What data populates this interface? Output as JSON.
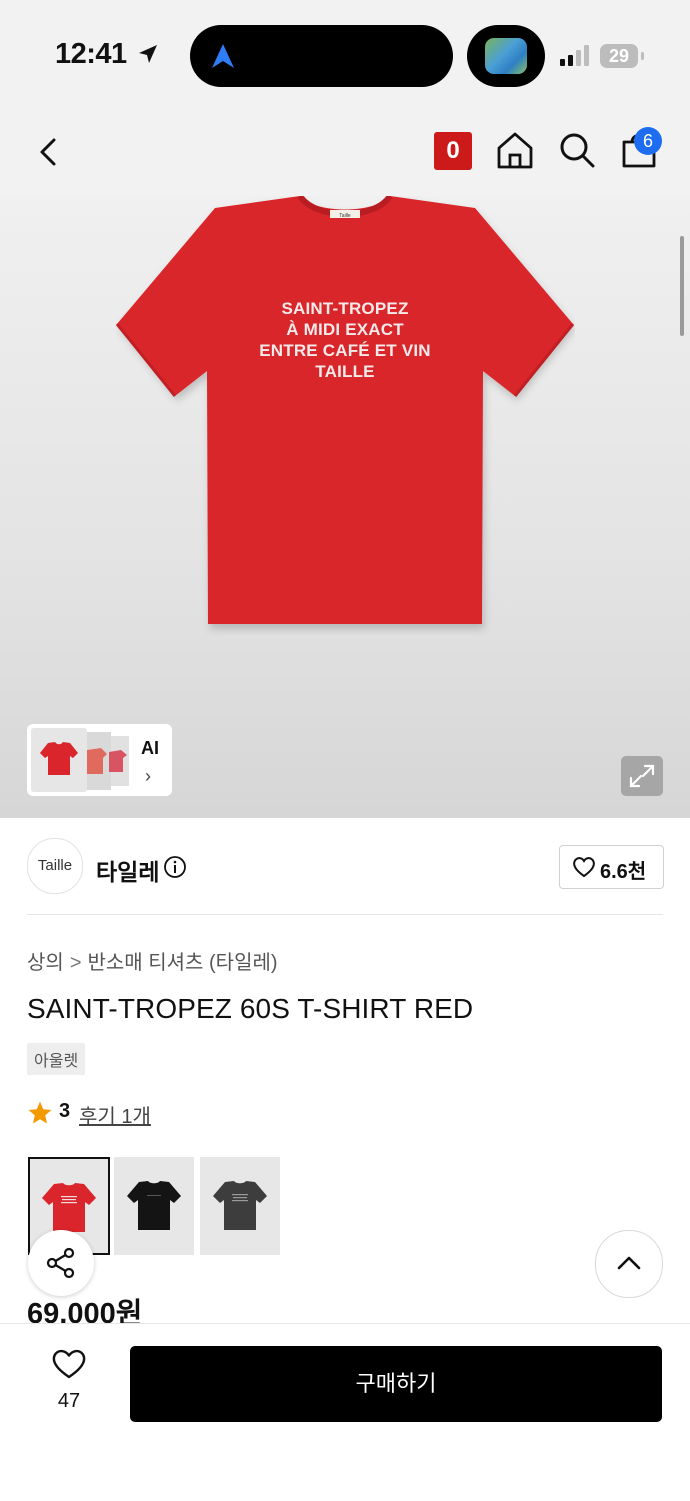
{
  "status_bar": {
    "time": "12:41",
    "battery": "29"
  },
  "nav": {
    "cart_zero_badge": "0",
    "cart_count": "6"
  },
  "product_image": {
    "shirt_text": [
      "SAINT-TROPEZ",
      "À MIDI EXACT",
      "ENTRE CAFÉ ET VIN",
      "TAILLE"
    ],
    "tag_text": "Taille",
    "ai_label": "AI",
    "ai_chevron": "›"
  },
  "brand": {
    "logo_text": "Taille",
    "name": "타일레",
    "likes": "6.6천"
  },
  "breadcrumb": {
    "category": "상의",
    "separator": ">",
    "subcategory": "반소매 티셔츠 (타일레)"
  },
  "product": {
    "title": "SAINT-TROPEZ 60S T-SHIRT RED",
    "badge": "아울렛",
    "rating": "3",
    "review_link": "후기 1개",
    "price": "69,000원",
    "variants": [
      "red",
      "black",
      "charcoal"
    ]
  },
  "bottom_bar": {
    "wish_count": "47",
    "buy_label": "구매하기"
  },
  "colors": {
    "shirt_red": "#d9252b",
    "accent_blue": "#1e6cf0",
    "badge_red": "#cc1a1a",
    "star": "#f29a00"
  }
}
